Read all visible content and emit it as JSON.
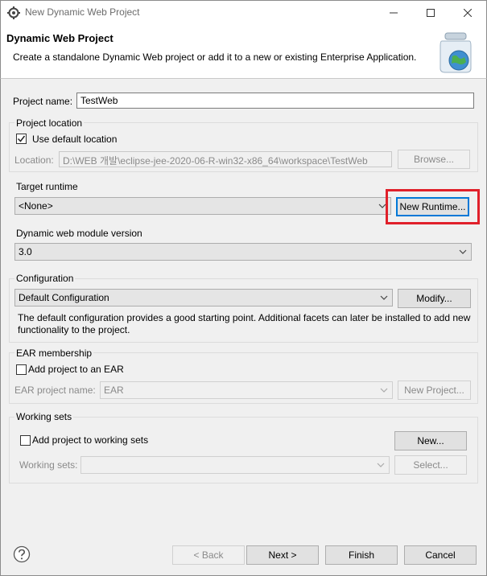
{
  "window": {
    "title": "New Dynamic Web Project"
  },
  "banner": {
    "heading": "Dynamic Web Project",
    "description": "Create a standalone Dynamic Web project or add it to a new or existing Enterprise Application."
  },
  "project_name": {
    "label": "Project name:",
    "value": "TestWeb"
  },
  "project_location": {
    "group_label": "Project location",
    "use_default_label": "Use default location",
    "use_default_checked": true,
    "location_label": "Location:",
    "location_value": "D:\\WEB 개발\\eclipse-jee-2020-06-R-win32-x86_64\\workspace\\TestWeb",
    "browse_label": "Browse..."
  },
  "target_runtime": {
    "label": "Target runtime",
    "selected": "<None>",
    "new_runtime_label": "New Runtime..."
  },
  "module_version": {
    "label": "Dynamic web module version",
    "selected": "3.0"
  },
  "configuration": {
    "label": "Configuration",
    "selected": "Default Configuration",
    "modify_label": "Modify...",
    "description": "The default configuration provides a good starting point. Additional facets can later be installed to add new functionality to the project."
  },
  "ear": {
    "group_label": "EAR membership",
    "add_label": "Add project to an EAR",
    "add_checked": false,
    "project_name_label": "EAR project name:",
    "project_name_value": "EAR",
    "new_project_label": "New Project..."
  },
  "working_sets": {
    "group_label": "Working sets",
    "add_label": "Add project to working sets",
    "add_checked": false,
    "new_label": "New...",
    "sets_label": "Working sets:",
    "select_label": "Select..."
  },
  "footer": {
    "back_label": "< Back",
    "next_label": "Next >",
    "finish_label": "Finish",
    "cancel_label": "Cancel"
  },
  "colors": {
    "highlight": "#e0202a",
    "focus": "#0078d7"
  }
}
